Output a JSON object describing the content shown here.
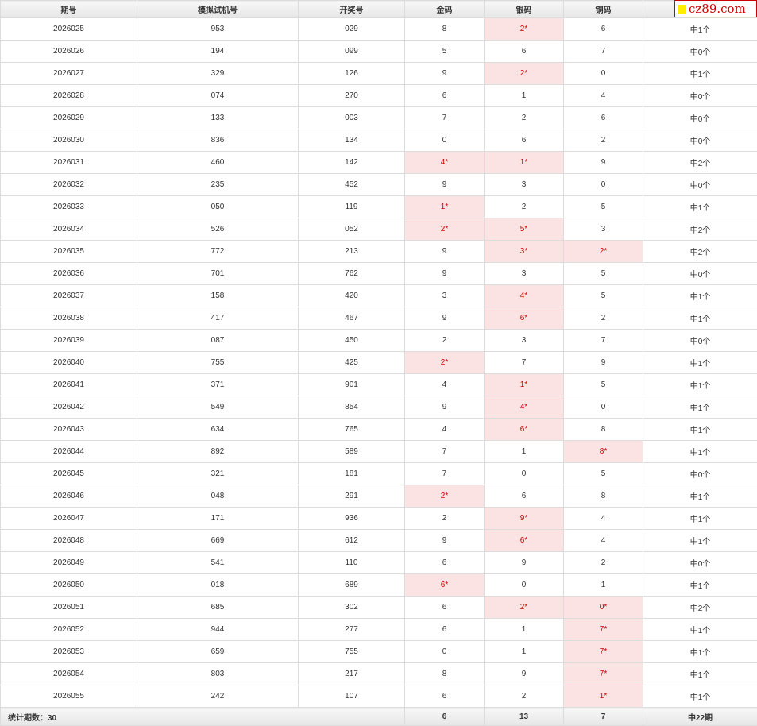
{
  "columns": [
    "期号",
    "模拟试机号",
    "开奖号",
    "金码",
    "银码",
    "铜码",
    ""
  ],
  "rows": [
    {
      "issue": "2026025",
      "sim": "953",
      "draw": "029",
      "gold": "8",
      "gold_hit": false,
      "silver": "2*",
      "silver_hit": true,
      "bronze": "6",
      "bronze_hit": false,
      "result": "中1个"
    },
    {
      "issue": "2026026",
      "sim": "194",
      "draw": "099",
      "gold": "5",
      "gold_hit": false,
      "silver": "6",
      "silver_hit": false,
      "bronze": "7",
      "bronze_hit": false,
      "result": "中0个"
    },
    {
      "issue": "2026027",
      "sim": "329",
      "draw": "126",
      "gold": "9",
      "gold_hit": false,
      "silver": "2*",
      "silver_hit": true,
      "bronze": "0",
      "bronze_hit": false,
      "result": "中1个"
    },
    {
      "issue": "2026028",
      "sim": "074",
      "draw": "270",
      "gold": "6",
      "gold_hit": false,
      "silver": "1",
      "silver_hit": false,
      "bronze": "4",
      "bronze_hit": false,
      "result": "中0个"
    },
    {
      "issue": "2026029",
      "sim": "133",
      "draw": "003",
      "gold": "7",
      "gold_hit": false,
      "silver": "2",
      "silver_hit": false,
      "bronze": "6",
      "bronze_hit": false,
      "result": "中0个"
    },
    {
      "issue": "2026030",
      "sim": "836",
      "draw": "134",
      "gold": "0",
      "gold_hit": false,
      "silver": "6",
      "silver_hit": false,
      "bronze": "2",
      "bronze_hit": false,
      "result": "中0个"
    },
    {
      "issue": "2026031",
      "sim": "460",
      "draw": "142",
      "gold": "4*",
      "gold_hit": true,
      "silver": "1*",
      "silver_hit": true,
      "bronze": "9",
      "bronze_hit": false,
      "result": "中2个"
    },
    {
      "issue": "2026032",
      "sim": "235",
      "draw": "452",
      "gold": "9",
      "gold_hit": false,
      "silver": "3",
      "silver_hit": false,
      "bronze": "0",
      "bronze_hit": false,
      "result": "中0个"
    },
    {
      "issue": "2026033",
      "sim": "050",
      "draw": "119",
      "gold": "1*",
      "gold_hit": true,
      "silver": "2",
      "silver_hit": false,
      "bronze": "5",
      "bronze_hit": false,
      "result": "中1个"
    },
    {
      "issue": "2026034",
      "sim": "526",
      "draw": "052",
      "gold": "2*",
      "gold_hit": true,
      "silver": "5*",
      "silver_hit": true,
      "bronze": "3",
      "bronze_hit": false,
      "result": "中2个"
    },
    {
      "issue": "2026035",
      "sim": "772",
      "draw": "213",
      "gold": "9",
      "gold_hit": false,
      "silver": "3*",
      "silver_hit": true,
      "bronze": "2*",
      "bronze_hit": true,
      "result": "中2个"
    },
    {
      "issue": "2026036",
      "sim": "701",
      "draw": "762",
      "gold": "9",
      "gold_hit": false,
      "silver": "3",
      "silver_hit": false,
      "bronze": "5",
      "bronze_hit": false,
      "result": "中0个"
    },
    {
      "issue": "2026037",
      "sim": "158",
      "draw": "420",
      "gold": "3",
      "gold_hit": false,
      "silver": "4*",
      "silver_hit": true,
      "bronze": "5",
      "bronze_hit": false,
      "result": "中1个"
    },
    {
      "issue": "2026038",
      "sim": "417",
      "draw": "467",
      "gold": "9",
      "gold_hit": false,
      "silver": "6*",
      "silver_hit": true,
      "bronze": "2",
      "bronze_hit": false,
      "result": "中1个"
    },
    {
      "issue": "2026039",
      "sim": "087",
      "draw": "450",
      "gold": "2",
      "gold_hit": false,
      "silver": "3",
      "silver_hit": false,
      "bronze": "7",
      "bronze_hit": false,
      "result": "中0个"
    },
    {
      "issue": "2026040",
      "sim": "755",
      "draw": "425",
      "gold": "2*",
      "gold_hit": true,
      "silver": "7",
      "silver_hit": false,
      "bronze": "9",
      "bronze_hit": false,
      "result": "中1个"
    },
    {
      "issue": "2026041",
      "sim": "371",
      "draw": "901",
      "gold": "4",
      "gold_hit": false,
      "silver": "1*",
      "silver_hit": true,
      "bronze": "5",
      "bronze_hit": false,
      "result": "中1个"
    },
    {
      "issue": "2026042",
      "sim": "549",
      "draw": "854",
      "gold": "9",
      "gold_hit": false,
      "silver": "4*",
      "silver_hit": true,
      "bronze": "0",
      "bronze_hit": false,
      "result": "中1个"
    },
    {
      "issue": "2026043",
      "sim": "634",
      "draw": "765",
      "gold": "4",
      "gold_hit": false,
      "silver": "6*",
      "silver_hit": true,
      "bronze": "8",
      "bronze_hit": false,
      "result": "中1个"
    },
    {
      "issue": "2026044",
      "sim": "892",
      "draw": "589",
      "gold": "7",
      "gold_hit": false,
      "silver": "1",
      "silver_hit": false,
      "bronze": "8*",
      "bronze_hit": true,
      "result": "中1个"
    },
    {
      "issue": "2026045",
      "sim": "321",
      "draw": "181",
      "gold": "7",
      "gold_hit": false,
      "silver": "0",
      "silver_hit": false,
      "bronze": "5",
      "bronze_hit": false,
      "result": "中0个"
    },
    {
      "issue": "2026046",
      "sim": "048",
      "draw": "291",
      "gold": "2*",
      "gold_hit": true,
      "silver": "6",
      "silver_hit": false,
      "bronze": "8",
      "bronze_hit": false,
      "result": "中1个"
    },
    {
      "issue": "2026047",
      "sim": "171",
      "draw": "936",
      "gold": "2",
      "gold_hit": false,
      "silver": "9*",
      "silver_hit": true,
      "bronze": "4",
      "bronze_hit": false,
      "result": "中1个"
    },
    {
      "issue": "2026048",
      "sim": "669",
      "draw": "612",
      "gold": "9",
      "gold_hit": false,
      "silver": "6*",
      "silver_hit": true,
      "bronze": "4",
      "bronze_hit": false,
      "result": "中1个"
    },
    {
      "issue": "2026049",
      "sim": "541",
      "draw": "110",
      "gold": "6",
      "gold_hit": false,
      "silver": "9",
      "silver_hit": false,
      "bronze": "2",
      "bronze_hit": false,
      "result": "中0个"
    },
    {
      "issue": "2026050",
      "sim": "018",
      "draw": "689",
      "gold": "6*",
      "gold_hit": true,
      "silver": "0",
      "silver_hit": false,
      "bronze": "1",
      "bronze_hit": false,
      "result": "中1个"
    },
    {
      "issue": "2026051",
      "sim": "685",
      "draw": "302",
      "gold": "6",
      "gold_hit": false,
      "silver": "2*",
      "silver_hit": true,
      "bronze": "0*",
      "bronze_hit": true,
      "result": "中2个"
    },
    {
      "issue": "2026052",
      "sim": "944",
      "draw": "277",
      "gold": "6",
      "gold_hit": false,
      "silver": "1",
      "silver_hit": false,
      "bronze": "7*",
      "bronze_hit": true,
      "result": "中1个"
    },
    {
      "issue": "2026053",
      "sim": "659",
      "draw": "755",
      "gold": "0",
      "gold_hit": false,
      "silver": "1",
      "silver_hit": false,
      "bronze": "7*",
      "bronze_hit": true,
      "result": "中1个"
    },
    {
      "issue": "2026054",
      "sim": "803",
      "draw": "217",
      "gold": "8",
      "gold_hit": false,
      "silver": "9",
      "silver_hit": false,
      "bronze": "7*",
      "bronze_hit": true,
      "result": "中1个"
    },
    {
      "issue": "2026055",
      "sim": "242",
      "draw": "107",
      "gold": "6",
      "gold_hit": false,
      "silver": "2",
      "silver_hit": false,
      "bronze": "1*",
      "bronze_hit": true,
      "result": "中1个"
    }
  ],
  "footer": {
    "label": "统计期数：30",
    "gold_total": "6",
    "silver_total": "13",
    "bronze_total": "7",
    "result_total": "中22期"
  },
  "watermark": {
    "text": "cz89.com"
  },
  "colors": {
    "hit_background": "#fbe3e4",
    "hit_text": "#cc0000",
    "watermark_red": "#cc0000",
    "watermark_yellow": "#ffee00",
    "header_background": "#ececec",
    "border": "#dcdcdc"
  }
}
